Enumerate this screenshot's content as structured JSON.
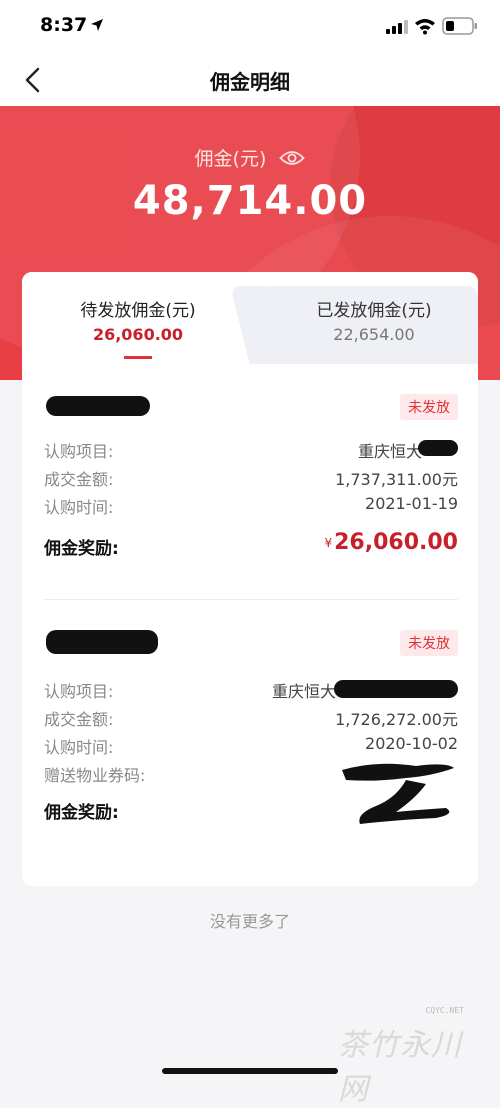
{
  "status_bar": {
    "time": "8:37"
  },
  "nav": {
    "title": "佣金明细"
  },
  "hero": {
    "label": "佣金(元)",
    "amount": "48,714.00"
  },
  "tabs": [
    {
      "label": "待发放佣金(元)",
      "amount": "26,060.00",
      "active": true
    },
    {
      "label": "已发放佣金(元)",
      "amount": "22,654.00",
      "active": false
    }
  ],
  "records": [
    {
      "status": "未发放",
      "rows": [
        {
          "label": "认购项目:",
          "value": "重庆恒大"
        },
        {
          "label": "成交金额:",
          "value": "1,737,311.00元"
        },
        {
          "label": "认购时间:",
          "value": "2021-01-19"
        }
      ],
      "reward_label": "佣金奖励:",
      "reward_currency": "¥",
      "reward_value": "26,060.00"
    },
    {
      "status": "未发放",
      "rows": [
        {
          "label": "认购项目:",
          "value": "重庆恒大"
        },
        {
          "label": "成交金额:",
          "value": "1,726,272.00元"
        },
        {
          "label": "认购时间:",
          "value": "2020-10-02"
        },
        {
          "label": "赠送物业券码:",
          "value": ""
        }
      ],
      "reward_label": "佣金奖励:",
      "reward_value": ""
    }
  ],
  "footer": {
    "no_more": "没有更多了"
  },
  "watermark": {
    "url": "CQYC.NET",
    "text": "茶竹永川网"
  },
  "colors": {
    "brand_red": "#e83f45",
    "amount_red": "#c8202a",
    "badge_bg": "#fde9ea"
  },
  "icons": [
    "location-arrow-icon",
    "signal-icon",
    "wifi-icon",
    "battery-icon",
    "back-chevron-icon",
    "eye-icon"
  ]
}
